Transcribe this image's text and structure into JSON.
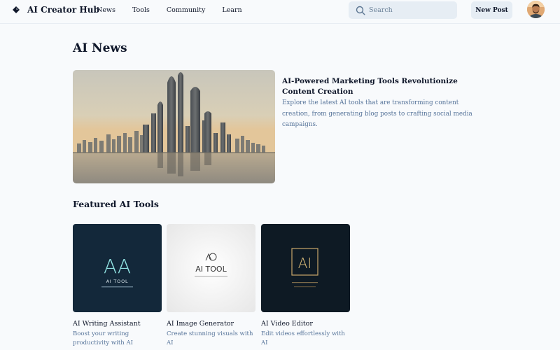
{
  "app": {
    "title": "AI Creator Hub"
  },
  "nav": {
    "items": [
      {
        "label": "News"
      },
      {
        "label": "Tools"
      },
      {
        "label": "Community"
      },
      {
        "label": "Learn"
      }
    ]
  },
  "search": {
    "placeholder": "Search"
  },
  "header": {
    "new_post_label": "New Post"
  },
  "main": {
    "title": "AI News",
    "featured_article": {
      "title": "AI-Powered Marketing Tools Revolutionize Content Creation",
      "description": "Explore the latest AI tools that are transforming content creation, from generating blog posts to crafting social media campaigns."
    },
    "tools_section_title": "Featured AI Tools",
    "tools": [
      {
        "name": "AI Writing Assistant",
        "description": "Boost your writing productivity with AI",
        "image_logo": "AA",
        "image_caption": "AI TOOL"
      },
      {
        "name": "AI Image Generator",
        "description": "Create stunning visuals with AI",
        "image_logo": "AI TOOL"
      },
      {
        "name": "AI Video Editor",
        "description": "Edit videos effortlessly with AI",
        "image_logo": "AI"
      }
    ]
  },
  "colors": {
    "background": "#f8fafc",
    "muted_text": "#557399",
    "input_bg": "#e6edf4"
  }
}
